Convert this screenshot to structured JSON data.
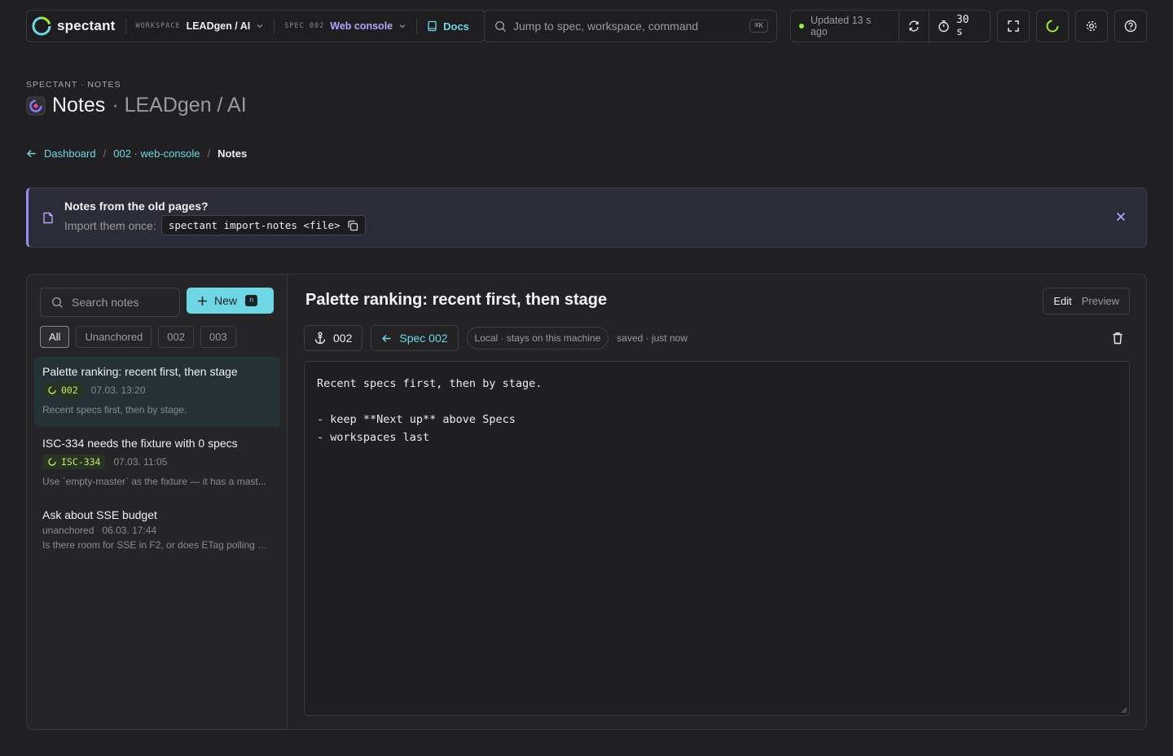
{
  "topbar": {
    "brand": "spectant",
    "workspace_key": "WORKSPACE",
    "workspace_value": "LEADgen / AI",
    "spec_key": "SPEC 002",
    "spec_value": "Web console",
    "docs": "Docs",
    "search_placeholder": "Jump to spec, workspace, command",
    "search_kbd": "⌘K",
    "updated": "Updated 13 s ago",
    "timer": "30 s"
  },
  "header": {
    "eyebrow": "SPECTANT · NOTES",
    "title": "Notes",
    "subtitle": "· LEADgen / AI"
  },
  "breadcrumb": {
    "dashboard": "Dashboard",
    "spec": "002 · web-console",
    "current": "Notes",
    "sep": "/"
  },
  "banner": {
    "title": "Notes from the old pages?",
    "subtitle": "Import them once:",
    "command": "spectant import-notes <file>"
  },
  "sidebar": {
    "search_placeholder": "Search notes",
    "new_label": "New",
    "new_kbd": "n",
    "filters": [
      "All",
      "Unanchored",
      "002",
      "003"
    ],
    "notes": [
      {
        "title": "Palette ranking: recent first, then stage",
        "tag": "002",
        "date": "07.03. 13:20",
        "preview": "Recent specs first, then by stage."
      },
      {
        "title": "ISC-334 needs the fixture with 0 specs",
        "tag": "ISC-334",
        "date": "07.03. 11:05",
        "preview": "Use `empty-master` as the fixture — it has a mast..."
      },
      {
        "title": "Ask about SSE budget",
        "tag": "unanchored",
        "date": "06.03. 17:44",
        "preview": "Is there room for SSE in F2, or does ETag polling st..."
      }
    ]
  },
  "editor": {
    "title": "Palette ranking: recent first, then stage",
    "mode_edit": "Edit",
    "mode_preview": "Preview",
    "anchor": "002",
    "spec_link": "Spec 002",
    "storage": "Local · stays on this machine",
    "saved": "saved · just now",
    "body": "Recent specs first, then by stage.\n\n- keep **Next up** above Specs\n- workspaces last"
  }
}
